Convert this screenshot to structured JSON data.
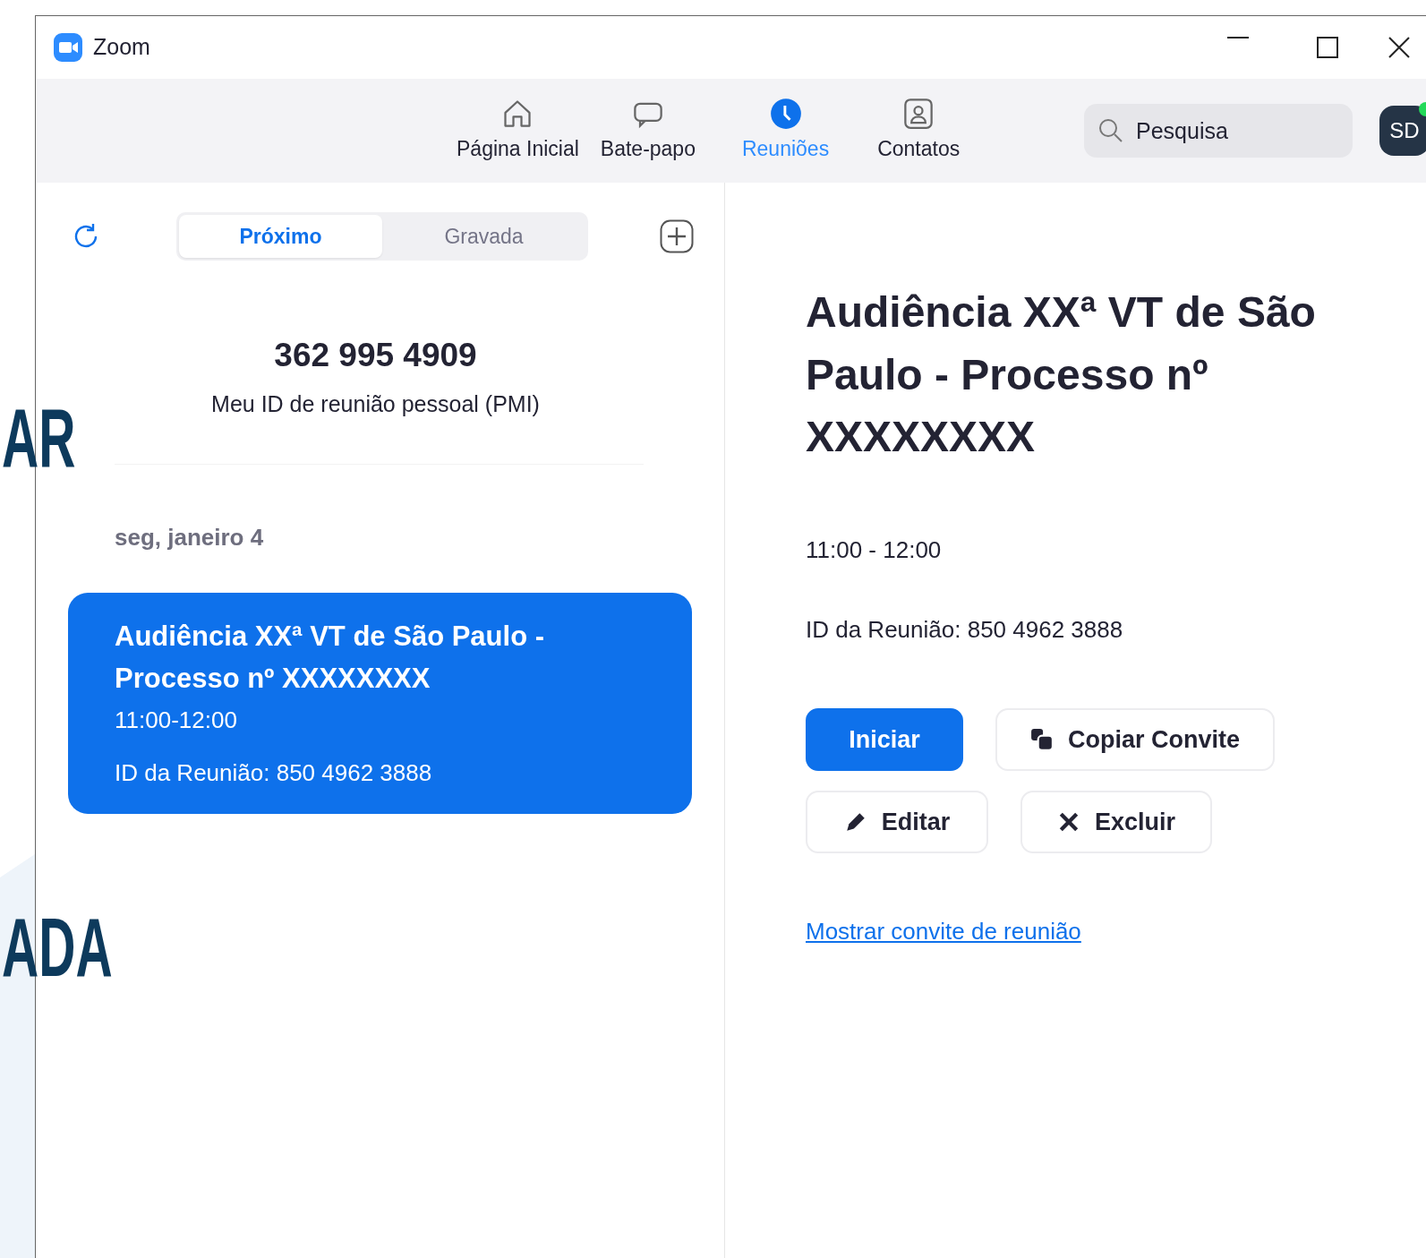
{
  "background_texts": [
    "AR",
    "ADA"
  ],
  "window": {
    "title": "Zoom"
  },
  "nav": [
    {
      "label": "Página Inicial",
      "selected": false
    },
    {
      "label": "Bate-papo",
      "selected": false
    },
    {
      "label": "Reuniões",
      "selected": true
    },
    {
      "label": "Contatos",
      "selected": false
    }
  ],
  "search": {
    "placeholder": "Pesquisa"
  },
  "avatar": {
    "initials": "SD",
    "online": true
  },
  "segments": [
    {
      "label": "Próximo",
      "selected": true
    },
    {
      "label": "Gravada",
      "selected": false
    }
  ],
  "pmi": {
    "number": "362 995 4909",
    "label": "Meu ID de reunião pessoal (PMI)"
  },
  "date_heading": "seg, janeiro 4",
  "meetings": [
    {
      "title": "Audiência XXª VT de São Paulo - Processo nº XXXXXXXX",
      "time": "11:00-12:00",
      "meeting_id": "ID da Reunião: 850 4962 3888",
      "selected": true
    }
  ],
  "detail": {
    "title": "Audiência XXª VT de São Paulo - Processo nº XXXXXXXX",
    "time": "11:00 - 12:00",
    "meeting_id": "ID da Reunião: 850 4962 3888",
    "buttons": [
      {
        "label": "Iniciar",
        "kind": "primary"
      },
      {
        "label": "Copiar Convite",
        "kind": "copy"
      },
      {
        "label": "Editar",
        "kind": "edit"
      },
      {
        "label": "Excluir",
        "kind": "delete"
      }
    ],
    "link": "Mostrar convite de reunião"
  }
}
